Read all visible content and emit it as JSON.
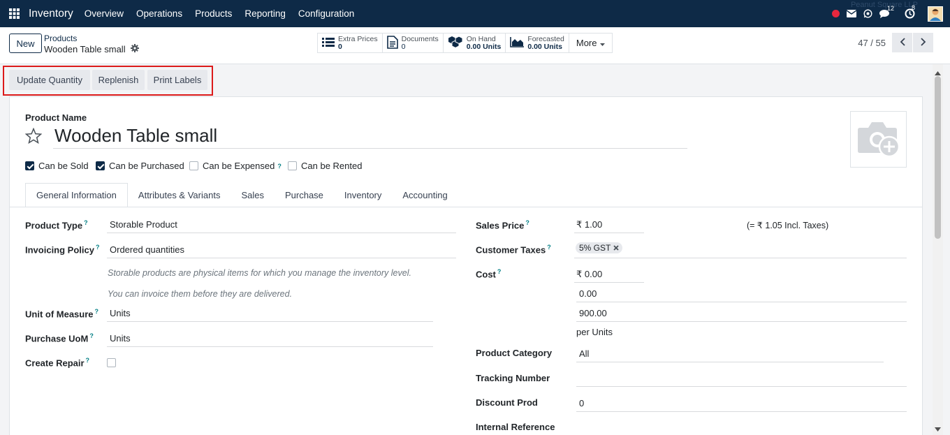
{
  "navbar": {
    "app_title": "Inventory",
    "menu": [
      "Overview",
      "Operations",
      "Products",
      "Reporting",
      "Configuration"
    ],
    "chat_count": "12",
    "activity_count": "8",
    "company_name": "Peanut Square LLP",
    "colors": {
      "bar": "#0e2a47",
      "status_dot": "#e8273e"
    }
  },
  "control": {
    "new_label": "New",
    "breadcrumb_parent": "Products",
    "breadcrumb_current": "Wooden Table small",
    "smart_buttons": [
      {
        "label": "Extra Prices",
        "value": "0",
        "icon": "list-icon"
      },
      {
        "label": "Documents",
        "value": "0",
        "icon": "document-icon"
      },
      {
        "label": "On Hand",
        "value": "0.00 Units",
        "icon": "cubes-icon"
      },
      {
        "label": "Forecasted",
        "value": "0.00 Units",
        "icon": "area-chart-icon"
      }
    ],
    "more_label": "More",
    "pager": "47 / 55"
  },
  "actions": [
    "Update Quantity",
    "Replenish",
    "Print Labels"
  ],
  "form": {
    "product_name_label": "Product Name",
    "product_name": "Wooden Table small",
    "checkboxes": [
      {
        "label": "Can be Sold",
        "checked": true
      },
      {
        "label": "Can be Purchased",
        "checked": true
      },
      {
        "label": "Can be Expensed",
        "checked": false,
        "help": "?"
      },
      {
        "label": "Can be Rented",
        "checked": false
      }
    ],
    "tabs": [
      "General Information",
      "Attributes & Variants",
      "Sales",
      "Purchase",
      "Inventory",
      "Accounting"
    ],
    "left": {
      "product_type_label": "Product Type",
      "product_type": "Storable Product",
      "invoicing_policy_label": "Invoicing Policy",
      "invoicing_policy": "Ordered quantities",
      "storable_note": "Storable products are physical items for which you manage the inventory level.",
      "invoice_note": "You can invoice them before they are delivered.",
      "uom_label": "Unit of Measure",
      "uom": "Units",
      "purchase_uom_label": "Purchase UoM",
      "purchase_uom": "Units",
      "create_repair_label": "Create Repair"
    },
    "right": {
      "sales_price_label": "Sales Price",
      "sales_price": "₹ 1.00",
      "incl_taxes": "(= ₹ 1.05 Incl. Taxes)",
      "customer_taxes_label": "Customer Taxes",
      "tax_tag": "5% GST",
      "cost_label": "Cost",
      "cost": "₹ 0.00",
      "cost_line2": "0.00",
      "cost_line3": "900.00",
      "per_units": "per Units",
      "category_label": "Product Category",
      "category": "All",
      "tracking_label": "Tracking Number",
      "discount_label": "Discount Prod",
      "discount": "0",
      "internal_ref_label": "Internal Reference"
    },
    "help_mark": "?"
  }
}
